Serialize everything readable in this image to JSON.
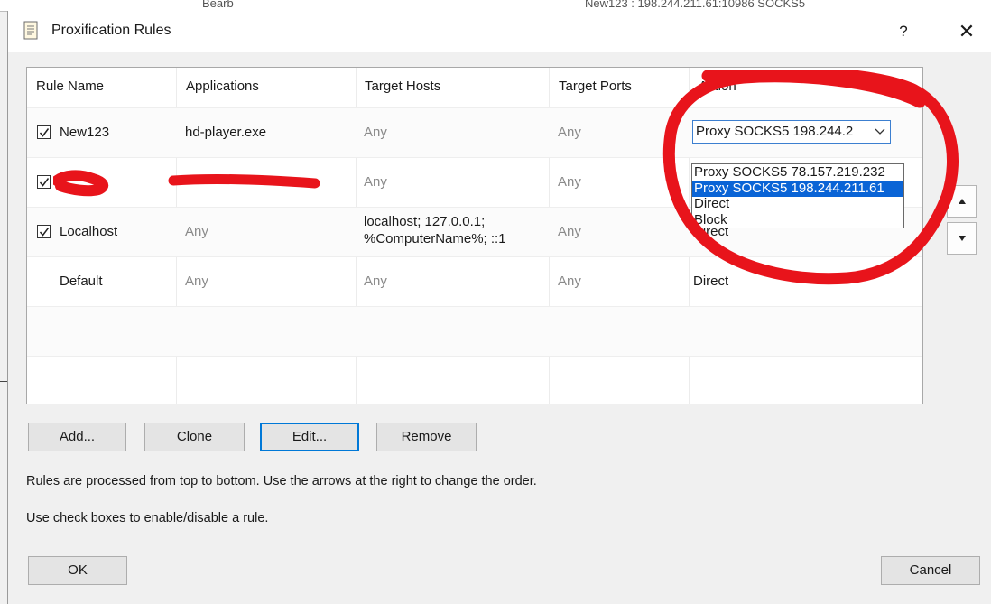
{
  "background_window": {
    "fragment_left": "Bearb",
    "fragment_right": "New123 : 198.244.211.61:10986 SOCKS5"
  },
  "window": {
    "title": "Proxification Rules",
    "help": "?",
    "close": "✕"
  },
  "table": {
    "columns": [
      "Rule Name",
      "Applications",
      "Target Hosts",
      "Target Ports",
      "Action"
    ],
    "rows": [
      {
        "name": "New123",
        "checked": true,
        "applications": "hd-player.exe",
        "hosts": "Any",
        "ports": "Any",
        "action": "Proxy SOCKS5 198.244.2"
      },
      {
        "name": "",
        "checked": true,
        "applications": "",
        "hosts": "Any",
        "ports": "Any",
        "action": ""
      },
      {
        "name": "Localhost",
        "checked": true,
        "applications": "Any",
        "hosts_line1": "localhost; 127.0.0.1;",
        "hosts_line2": "%ComputerName%; ::1",
        "ports": "Any",
        "action": "Direct"
      },
      {
        "name": "Default",
        "checked": false,
        "applications": "Any",
        "hosts": "Any",
        "ports": "Any",
        "action": "Direct"
      }
    ]
  },
  "dropdown": {
    "options": [
      "Proxy SOCKS5 78.157.219.232",
      "Proxy SOCKS5 198.244.211.61",
      "Direct",
      "Block"
    ],
    "selected_index": 1
  },
  "buttons": {
    "add": "Add...",
    "clone": "Clone",
    "edit": "Edit...",
    "remove": "Remove",
    "ok": "OK",
    "cancel": "Cancel"
  },
  "info": {
    "line1": "Rules are processed from top to bottom. Use the arrows at the right to change the order.",
    "line2": "Use check boxes to enable/disable a rule."
  },
  "colors": {
    "selection": "#0a64d6",
    "focus": "#0078d7",
    "annotation": "#e8141b"
  }
}
